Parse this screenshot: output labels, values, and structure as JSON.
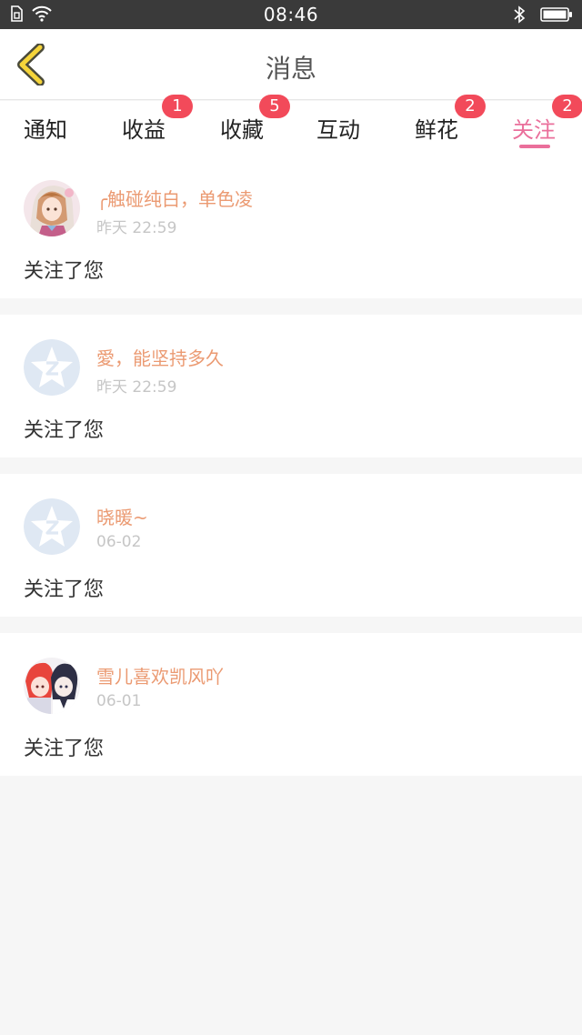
{
  "status_bar": {
    "time": "08:46"
  },
  "header": {
    "title": "消息"
  },
  "tabs": [
    {
      "label": "通知",
      "badge": ""
    },
    {
      "label": "收益",
      "badge": "1"
    },
    {
      "label": "收藏",
      "badge": "5"
    },
    {
      "label": "互动",
      "badge": ""
    },
    {
      "label": "鲜花",
      "badge": "2"
    },
    {
      "label": "关注",
      "badge": "2"
    }
  ],
  "active_tab": "关注",
  "colors": {
    "accent": "#ea6f9b",
    "badge": "#f24a5a",
    "username": "#eb9a72",
    "muted": "#c6c6c6"
  },
  "notifications": [
    {
      "username": "╭触碰纯白，单色凌",
      "time": "昨天 22:59",
      "message": "关注了您",
      "avatar": "anime-girl-avatar"
    },
    {
      "username": "愛，能坚持多久",
      "time": "昨天 22:59",
      "message": "关注了您",
      "avatar": "default-qq-avatar"
    },
    {
      "username": "晓暖~",
      "time": "06-02",
      "message": "关注了您",
      "avatar": "default-qq-avatar"
    },
    {
      "username": "雪儿喜欢凯风吖",
      "time": "06-01",
      "message": "关注了您",
      "avatar": "anime-couple-avatar"
    }
  ]
}
